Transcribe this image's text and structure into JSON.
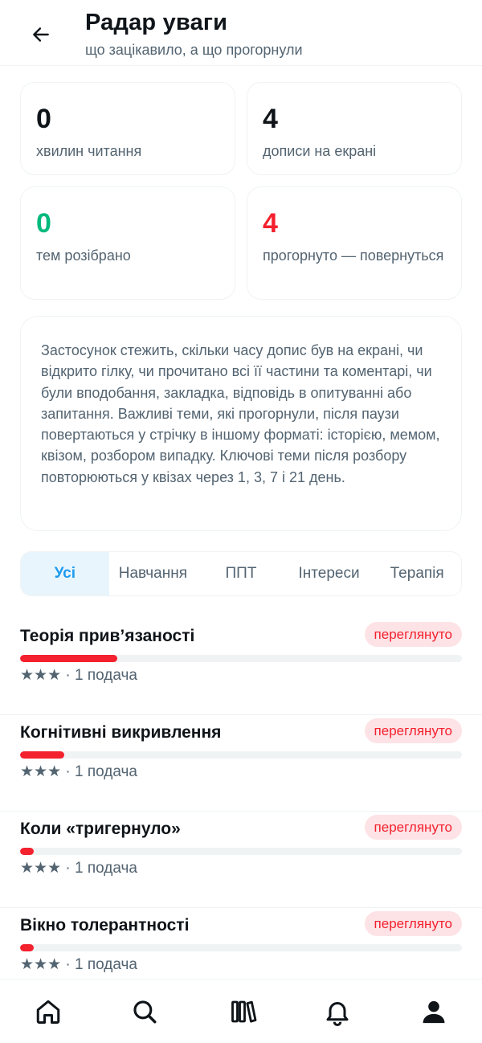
{
  "header": {
    "title": "Радар уваги",
    "subtitle": "що зацікавило, а що прогорнули"
  },
  "stats": [
    {
      "value": "0",
      "label": "хвилин читання",
      "color": "#0f1419"
    },
    {
      "value": "4",
      "label": "дописи на екрані",
      "color": "#0f1419"
    },
    {
      "value": "0",
      "label": "тем розібрано",
      "color": "#00ba7c"
    },
    {
      "value": "4",
      "label": "прогорнуто — повернуться",
      "color": "#f4212e"
    }
  ],
  "info_text": "Застосунок стежить, скільки часу допис був на екрані, чи відкрито гілку, чи прочитано всі її частини та коментарі, чи були вподобання, закладка, відповідь в опитуванні або запитання. Важливі теми, які прогорнули, після паузи повертаються у стрічку в іншому форматі: історією, мемом, квізом, розбором випадку. Ключові теми після розбору повторюються у квізах через 1, 3, 7 і 21 день.",
  "tabs": [
    "Усі",
    "Навчання",
    "ППТ",
    "Інтереси",
    "Терапія"
  ],
  "active_tab": "Усі",
  "topics": [
    {
      "title": "Теорія прив’язаності",
      "badge": "переглянуто",
      "progress": 0.22,
      "meta": "★★★ · 1 подача"
    },
    {
      "title": "Когнітивні викривлення",
      "badge": "переглянуто",
      "progress": 0.1,
      "meta": "★★★ · 1 подача"
    },
    {
      "title": "Коли «тригернуло»",
      "badge": "переглянуто",
      "progress": 0.03,
      "meta": "★★★ · 1 подача"
    },
    {
      "title": "Вікно толерантності",
      "badge": "переглянуто",
      "progress": 0.03,
      "meta": "★★★ · 1 подача"
    }
  ],
  "bottom_nav": [
    "home-icon",
    "search-icon",
    "library-icon",
    "bell-icon",
    "profile-icon"
  ],
  "colors": {
    "accent": "#1d9bf0",
    "danger": "#f4212e",
    "success": "#00ba7c",
    "muted": "#536471"
  }
}
